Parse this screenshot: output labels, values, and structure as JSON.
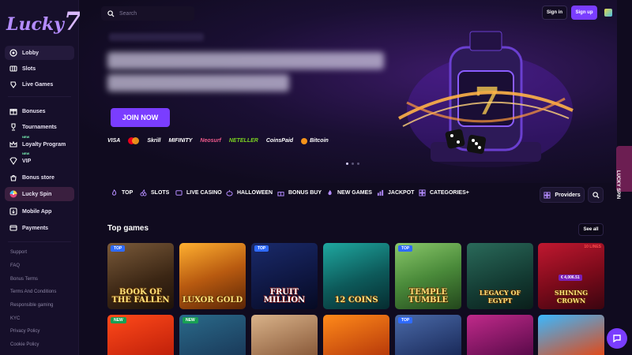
{
  "brand": {
    "logo_text": "Lucky",
    "logo_number": "7"
  },
  "sidebar": {
    "main": [
      {
        "label": "Lobby",
        "icon": "lobby-icon"
      },
      {
        "label": "Slots",
        "icon": "slots-icon"
      },
      {
        "label": "Live Games",
        "icon": "live-games-icon"
      }
    ],
    "promo": [
      {
        "label": "Bonuses",
        "icon": "gift-icon"
      },
      {
        "label": "Tournaments",
        "icon": "trophy-icon"
      },
      {
        "label": "Loyalty Program",
        "icon": "crown-icon",
        "badge": "NEW"
      },
      {
        "label": "VIP",
        "icon": "vip-icon",
        "badge": "NEW"
      },
      {
        "label": "Bonus store",
        "icon": "store-icon"
      },
      {
        "label": "Lucky Spin",
        "icon": "wheel-icon"
      },
      {
        "label": "Mobile App",
        "icon": "download-icon"
      },
      {
        "label": "Payments",
        "icon": "card-icon"
      }
    ],
    "footer": [
      "Support",
      "FAQ",
      "Bonus Terms",
      "Terms And Conditions",
      "Responsible gaming",
      "KYC",
      "Privacy Policy",
      "Cookie Policy"
    ]
  },
  "header": {
    "search_placeholder": "Search",
    "signin": "Sign in",
    "signup": "Sign up"
  },
  "hero": {
    "cta": "JOIN NOW",
    "payments": [
      "VISA",
      "Skrill",
      "MIFINITY",
      "Neosurf",
      "NETELLER",
      "CoinsPaid",
      "Bitcoin"
    ]
  },
  "lucky_tab": "LUCKY SPIN",
  "categories": [
    "TOP",
    "SLOTS",
    "LIVE CASINO",
    "HALLOWEEN",
    "BONUS BUY",
    "NEW GAMES",
    "JACKPOT",
    "CATEGORIES+"
  ],
  "providers_label": "Providers",
  "top_games": {
    "title": "Top games",
    "see_all": "See all",
    "row1": [
      {
        "title": "BOOK OF THE FALLEN",
        "tag": "TOP"
      },
      {
        "title": "LUXOR GOLD",
        "tag": ""
      },
      {
        "title": "FRUIT MILLION",
        "tag": "TOP"
      },
      {
        "title": "12 COINS",
        "tag": ""
      },
      {
        "title": "TEMPLE TUMBLE",
        "tag": "TOP"
      },
      {
        "title": "LEGACY OF EGYPT",
        "tag": ""
      },
      {
        "title": "SHINING CROWN",
        "tag": "",
        "corner": "10 LINES",
        "amount": "€ 4,006.51"
      }
    ],
    "row2_tags": [
      "NEW",
      "NEW",
      "",
      "",
      "TOP",
      "",
      ""
    ]
  }
}
